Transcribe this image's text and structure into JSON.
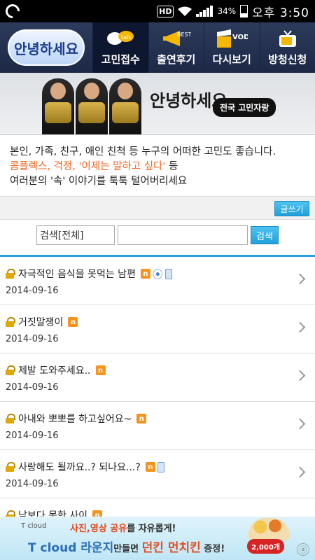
{
  "status_bar": {
    "hd": "HD",
    "battery_percent": "34%",
    "battery_level": 0.34,
    "time": "오후 3:50"
  },
  "nav": {
    "logo_text": "안녕하세요",
    "tabs": [
      {
        "label": "고민접수",
        "icon": "talk-bubble-icon",
        "badge": "talk",
        "active": true
      },
      {
        "label": "출연후기",
        "icon": "megaphone-icon",
        "badge": "BEST",
        "active": false
      },
      {
        "label": "다시보기",
        "icon": "clapperboard-icon",
        "badge": "VOD",
        "active": false
      },
      {
        "label": "방청신청",
        "icon": "tv-icon",
        "active": false
      }
    ]
  },
  "banner": {
    "title": "안녕하세요",
    "subtitle": "전국 고민자랑"
  },
  "intro": {
    "line1": "본인, 가족, 친구, 애인 친척 등 누구의 어떠한 고민도 좋습니다.",
    "line2_highlight": "콤플렉스, 걱정, '이제는 말하고 싶다'",
    "line2_rest": " 등",
    "line3": "여러분의 '속' 이야기를 툭툭 털어버리세요"
  },
  "write_button": "글쓰기",
  "search": {
    "scope": "검색[전체]",
    "query": "",
    "button": "검색"
  },
  "posts": [
    {
      "title": "자극적인 음식을 못먹는 남편",
      "date": "2014-09-16",
      "new": "n",
      "attachment": true,
      "mobile": true
    },
    {
      "title": "거짓말쟁이",
      "date": "2014-09-16",
      "new": "n",
      "attachment": false,
      "mobile": false
    },
    {
      "title": "제발 도와주세요..",
      "date": "2014-09-16",
      "new": "n",
      "attachment": false,
      "mobile": false
    },
    {
      "title": "아내와 뽀뽀를 하고싶어요~",
      "date": "2014-09-16",
      "new": "n",
      "attachment": false,
      "mobile": false
    },
    {
      "title": "사랑해도 될까요..? 되나요...?",
      "date": "2014-09-16",
      "new": "n",
      "attachment": false,
      "mobile": true
    },
    {
      "title": "남보다 못한 사이",
      "date": "",
      "new": "n",
      "attachment": false,
      "mobile": false
    }
  ],
  "ad": {
    "brand": "T cloud",
    "line1_pre": "사진,영상 공유",
    "line1_post": "를 자유롭게!",
    "line2_brand": "T cloud 라운지",
    "line2_mid": "만들면 ",
    "line2_prize": "던킨 먼치킨",
    "line2_end": " 증정!",
    "badge": "2,000개",
    "close": "ⓐ"
  },
  "colors": {
    "accent_blue": "#29a3df",
    "highlight_orange": "#f26522",
    "nav_bg": "#1c2846"
  }
}
